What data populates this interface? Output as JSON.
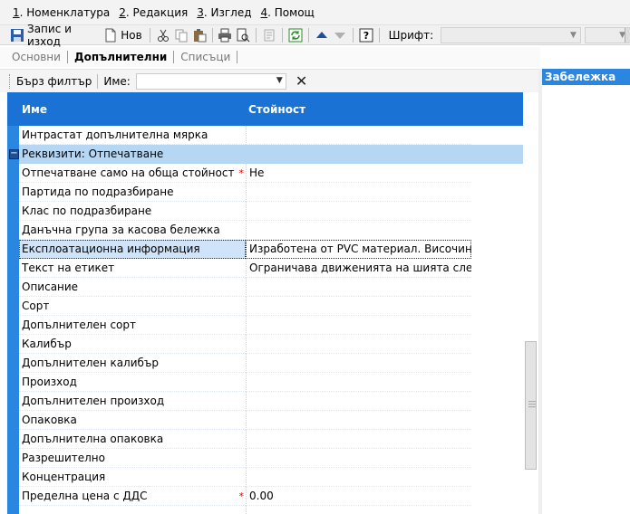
{
  "menu": [
    {
      "key": "1",
      "rest": ". Номенклатура"
    },
    {
      "key": "2",
      "rest": ". Редакция"
    },
    {
      "key": "3",
      "rest": ". Изглед"
    },
    {
      "key": "4",
      "rest": ". Помощ"
    }
  ],
  "toolbar": {
    "save_label": "Запис и изход",
    "new_label": "Нов",
    "font_label": "Шрифт:",
    "font_value": "",
    "size_value": ""
  },
  "tabs": [
    {
      "label": "Основни",
      "active": false
    },
    {
      "label": "Допълнителни",
      "active": true
    },
    {
      "label": "Списъци",
      "active": false
    }
  ],
  "filter": {
    "quick_filter_label": "Бърз филтър",
    "name_label": "Име:",
    "name_value": ""
  },
  "grid": {
    "col_name": "Име",
    "col_value": "Стойност",
    "rows": [
      {
        "type": "item",
        "name": "Интрастат допълнителна мярка",
        "value": ""
      },
      {
        "type": "group",
        "name": "Реквизити: Отпечатване"
      },
      {
        "type": "item",
        "name": "Отпечатване само на обща стойност",
        "value": "Не",
        "required": true
      },
      {
        "type": "item",
        "name": "Партида по подразбиране",
        "value": ""
      },
      {
        "type": "item",
        "name": "Клас по подразбиране",
        "value": ""
      },
      {
        "type": "item",
        "name": "Данъчна група за касова бележка",
        "value": ""
      },
      {
        "type": "item",
        "name": "Експлоатационна информация",
        "value": "Изработена от PVC материал. Височината на",
        "selected": true
      },
      {
        "type": "item",
        "name": "Текст на етикет",
        "value": "Ограничава движенията на шията след тр..."
      },
      {
        "type": "item",
        "name": "Описание",
        "value": ""
      },
      {
        "type": "item",
        "name": "Сорт",
        "value": ""
      },
      {
        "type": "item",
        "name": "Допълнителен сорт",
        "value": ""
      },
      {
        "type": "item",
        "name": "Калибър",
        "value": ""
      },
      {
        "type": "item",
        "name": "Допълнителен калибър",
        "value": ""
      },
      {
        "type": "item",
        "name": "Произход",
        "value": ""
      },
      {
        "type": "item",
        "name": "Допълнителен произход",
        "value": ""
      },
      {
        "type": "item",
        "name": "Опаковка",
        "value": ""
      },
      {
        "type": "item",
        "name": "Допълнителна опаковка",
        "value": ""
      },
      {
        "type": "item",
        "name": "Разрешително",
        "value": ""
      },
      {
        "type": "item",
        "name": "Концентрация",
        "value": ""
      },
      {
        "type": "item",
        "name": "Пределна цена с ДДС",
        "value": "0.00",
        "required": true
      },
      {
        "type": "item",
        "name": "",
        "value": ""
      }
    ]
  },
  "note_pane": {
    "title": "Забележка"
  },
  "colors": {
    "accent": "#1a73d4",
    "group_row": "#b6d7f4",
    "required": "#d00000"
  }
}
